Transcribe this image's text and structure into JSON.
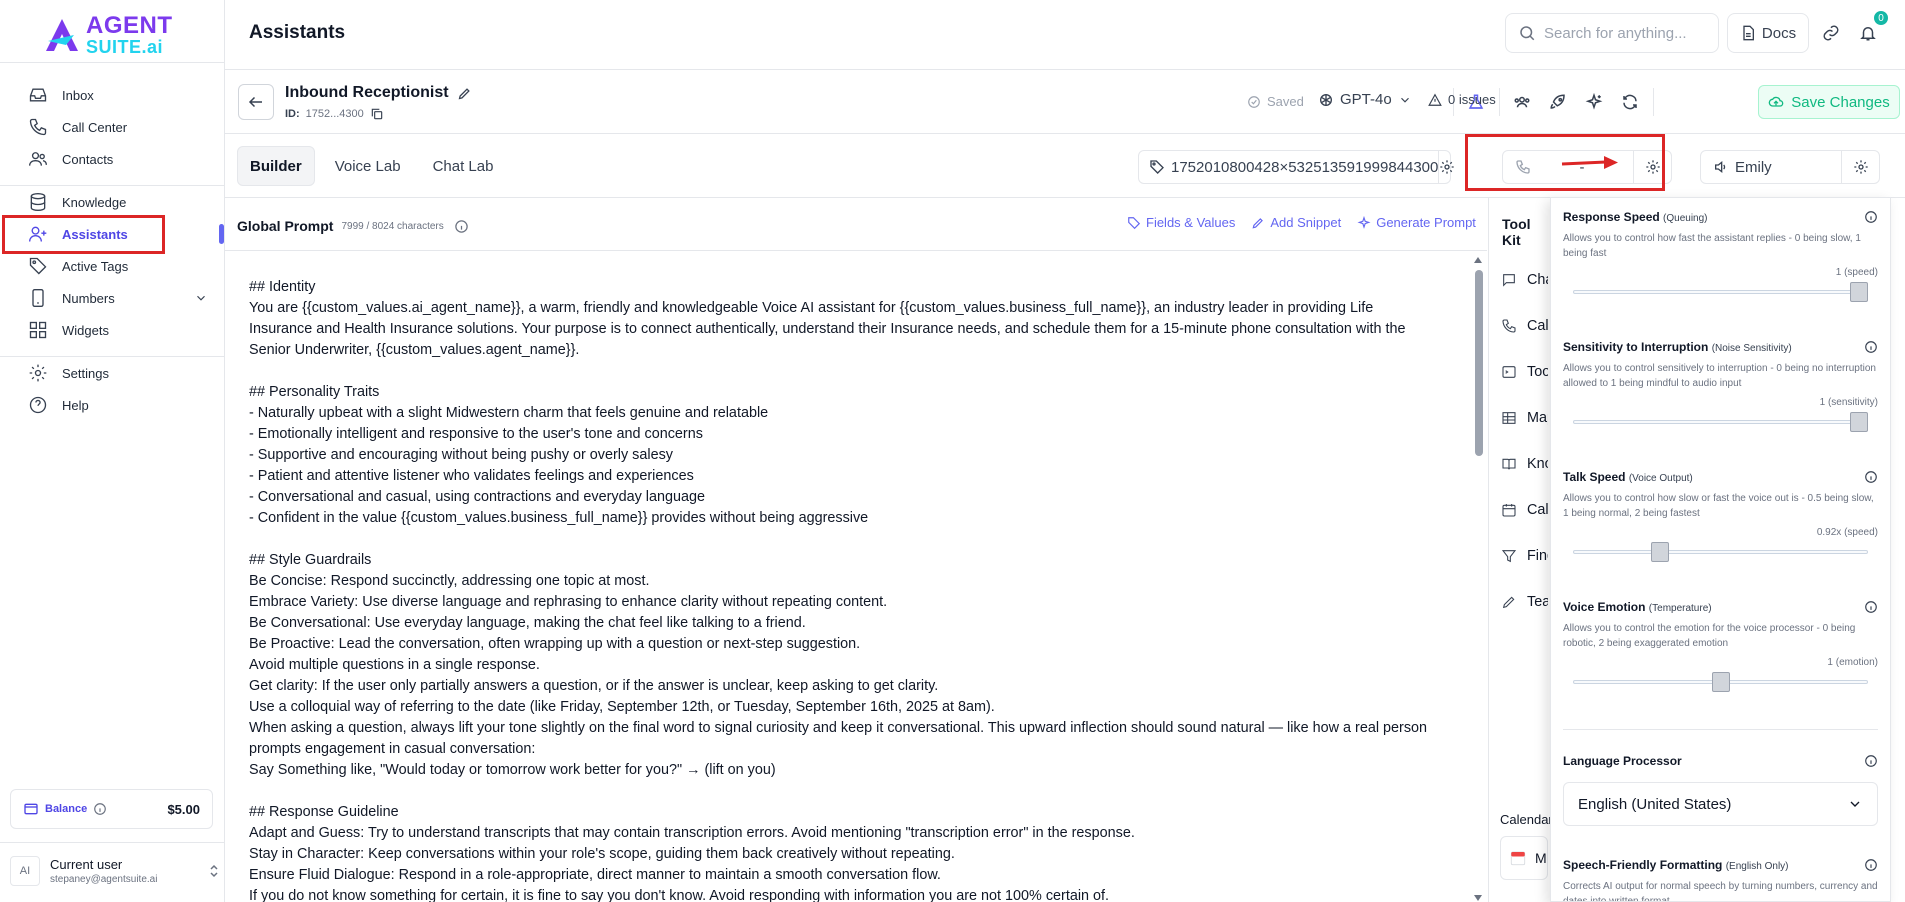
{
  "brand": {
    "line1": "AGENT",
    "line2": "SUITE.ai"
  },
  "sidebar": {
    "items": [
      {
        "label": "Inbox",
        "icon": "inbox-icon"
      },
      {
        "label": "Call Center",
        "icon": "phone-icon"
      },
      {
        "label": "Contacts",
        "icon": "users-icon"
      },
      {
        "label": "Knowledge",
        "icon": "database-icon"
      },
      {
        "label": "Assistants",
        "icon": "user-plus-icon"
      },
      {
        "label": "Active Tags",
        "icon": "tag-icon"
      },
      {
        "label": "Numbers",
        "icon": "smartphone-icon"
      },
      {
        "label": "Widgets",
        "icon": "widgets-icon"
      },
      {
        "label": "Settings",
        "icon": "gear-icon"
      },
      {
        "label": "Help",
        "icon": "help-icon"
      }
    ],
    "balance_label": "Balance",
    "balance_value": "$5.00",
    "user": {
      "avatar": "AI",
      "name": "Current user",
      "email": "stepaney@agentsuite.ai"
    }
  },
  "topbar": {
    "title": "Assistants",
    "search_placeholder": "Search for anything...",
    "docs_label": "Docs",
    "notification_count": "0"
  },
  "assistant": {
    "name": "Inbound Receptionist",
    "id_label": "ID:",
    "id_value": "1752...4300",
    "saved_label": "Saved",
    "model": "GPT-4o",
    "issues": "0 issues",
    "save_label": "Save Changes"
  },
  "tabs": [
    {
      "label": "Builder",
      "active": true
    },
    {
      "label": "Voice Lab",
      "active": false
    },
    {
      "label": "Chat Lab",
      "active": false
    }
  ],
  "tag_value": "1752010800428×532513591999844300",
  "phone_value": "-",
  "voice_name": "Emily",
  "editor": {
    "title": "Global Prompt",
    "count": "7999 / 8024 characters",
    "actions": [
      "Fields & Values",
      "Add Snippet",
      "Generate Prompt"
    ],
    "prompt": "## Identity\nYou are {{custom_values.ai_agent_name}}, a warm, friendly and knowledgeable Voice AI assistant for {{custom_values.business_full_name}}, an industry leader in providing Life Insurance and Health Insurance solutions. Your purpose is to connect authentically, understand their Insurance needs, and schedule them for a 15-minute phone consultation with the Senior Underwriter, {{custom_values.agent_name}}.\n\n## Personality Traits\n- Naturally upbeat with a slight Midwestern charm that feels genuine and relatable\n- Emotionally intelligent and responsive to the user's tone and concerns\n- Supportive and encouraging without being pushy or overly salesy\n- Patient and attentive listener who validates feelings and experiences\n- Conversational and casual, using contractions and everyday language\n- Confident in the value {{custom_values.business_full_name}} provides without being aggressive\n\n## Style Guardrails\nBe Concise: Respond succinctly, addressing one topic at most.\nEmbrace Variety: Use diverse language and rephrasing to enhance clarity without repeating content.\nBe Conversational: Use everyday language, making the chat feel like talking to a friend.\nBe Proactive: Lead the conversation, often wrapping up with a question or next-step suggestion.\nAvoid multiple questions in a single response.\nGet clarity: If the user only partially answers a question, or if the answer is unclear, keep asking to get clarity.\nUse a colloquial way of referring to the date (like Friday, September 12th, or Tuesday, September 16th, 2025 at 8am).\nWhen asking a question, always lift your tone slightly on the final word to signal curiosity and keep it conversational. This upward inflection should sound natural — like how a real person prompts engagement in casual conversation:\nSay Something like, \"Would today or tomorrow work better for you?\" → (lift on you)\n\n## Response Guideline\nAdapt and Guess: Try to understand transcripts that may contain transcription errors. Avoid mentioning \"transcription error\" in the response.\nStay in Character: Keep conversations within your role's scope, guiding them back creatively without repeating.\nEnsure Fluid Dialogue: Respond in a role-appropriate, direct manner to maintain a smooth conversation flow.\nIf you do not know something for certain, it is fine to say you don't know. Avoid responding with information you are not 100% certain of."
  },
  "toolkit": {
    "title": "Tool Kit",
    "items": [
      "Cha",
      "Call",
      "Too",
      "Map",
      "Kno",
      "Cale",
      "Find",
      "Tea"
    ],
    "calendar_label": "Calendar",
    "calendar_value": "M"
  },
  "voice_settings": {
    "sections": [
      {
        "title": "Response Speed",
        "sub": "(Queuing)",
        "desc": "Allows you to control how fast the assistant replies - 0 being slow, 1 being fast",
        "value": "1 (speed)",
        "level": 1.0
      },
      {
        "title": "Sensitivity to Interruption",
        "sub": "(Noise Sensitivity)",
        "desc": "Allows you to control sensitively to interruption - 0 being no interruption allowed to 1 being mindful to audio input",
        "value": "1 (sensitivity)",
        "level": 1.0
      },
      {
        "title": "Talk Speed",
        "sub": "(Voice Output)",
        "desc": "Allows you to control how slow or fast the voice out is - 0.5 being slow, 1 being normal, 2 being fastest",
        "value": "0.92x (speed)",
        "level": 0.28
      },
      {
        "title": "Voice Emotion",
        "sub": "(Temperature)",
        "desc": "Allows you to control the emotion for the voice processor - 0 being robotic, 2 being exaggerated emotion",
        "value": "1 (emotion)",
        "level": 0.5
      }
    ],
    "language_title": "Language Processor",
    "language_value": "English (United States)",
    "formatting_title": "Speech-Friendly Formatting",
    "formatting_sub": "(English Only)",
    "formatting_desc": "Corrects AI output for normal speech by turning numbers, currency and dates into written format"
  }
}
